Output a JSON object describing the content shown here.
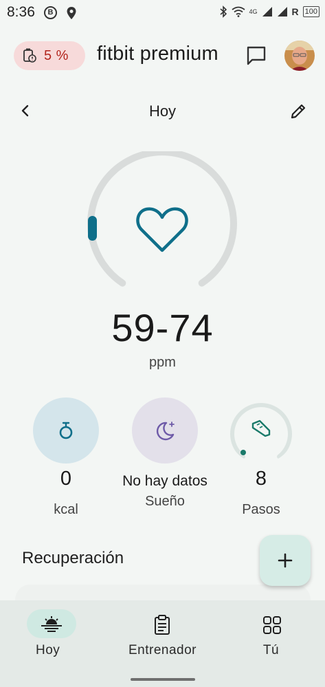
{
  "status_bar": {
    "time": "8:36",
    "b_badge": "B",
    "signal_text": "4G",
    "roaming": "R",
    "battery": "100"
  },
  "header": {
    "battery_percent": "5 %",
    "title": "fitbit premium"
  },
  "subheader": {
    "title": "Hoy"
  },
  "heart_rate": {
    "value": "59-74",
    "unit": "ppm",
    "gauge_fraction": 0.06
  },
  "stats": [
    {
      "value": "0",
      "label": "kcal"
    },
    {
      "value": "No hay datos",
      "label": "Sueño"
    },
    {
      "value": "8",
      "label": "Pasos",
      "progress": 0.02
    }
  ],
  "recovery": {
    "title": "Recuperación"
  },
  "nav": [
    {
      "label": "Hoy",
      "icon": "today-icon",
      "active": true
    },
    {
      "label": "Entrenador",
      "icon": "clipboard-icon",
      "active": false
    },
    {
      "label": "Tú",
      "icon": "grid-icon",
      "active": false
    }
  ],
  "colors": {
    "accent": "#0f6f8a",
    "battery_low": "#b3261e",
    "fab_bg": "#d6ece6",
    "steps_accent": "#1a7a6a"
  }
}
